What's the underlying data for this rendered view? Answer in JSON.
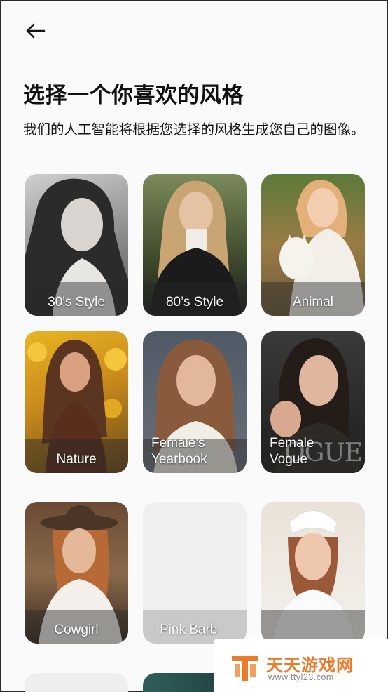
{
  "header": {
    "back_icon": "arrow-left-icon"
  },
  "page": {
    "title": "选择一个你喜欢的风格",
    "subtitle": "我们的人工智能将根据您选择的风格生成您自己的图像。"
  },
  "styles": [
    {
      "label": "30's Style",
      "tone": "grayscale"
    },
    {
      "label": "80’s Style",
      "tone": "dark"
    },
    {
      "label": "Animal",
      "tone": "sunlit"
    },
    {
      "label": "Nature",
      "tone": "sunflower"
    },
    {
      "label_line1": "Female's",
      "label_line2": "Yearbook",
      "tone": "soft"
    },
    {
      "label_line1": "Female",
      "label_line2": "Vogue",
      "overlay_text": "OGUE",
      "tone": "dark"
    },
    {
      "label": "Cowgirl",
      "tone": "warm"
    },
    {
      "label": "Pink Barb",
      "tone": "blank"
    },
    {
      "label": "",
      "tone": "white"
    }
  ],
  "watermark": {
    "name_cn": "天天游戏网",
    "url": "www.ttyl23.com",
    "accent": "#ea7a2c"
  }
}
